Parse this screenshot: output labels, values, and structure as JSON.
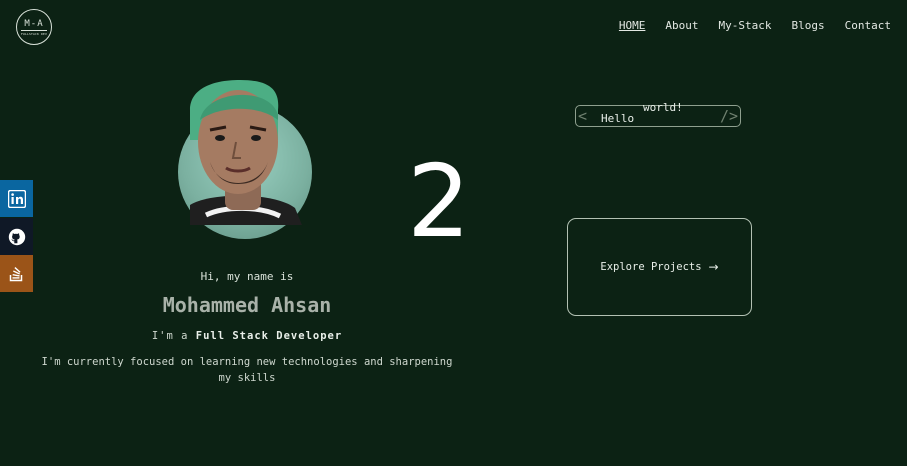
{
  "logo": {
    "initials": "M-A",
    "tagline": "FULLSTACK DEV"
  },
  "nav": {
    "items": [
      {
        "label": "HOME",
        "active": true
      },
      {
        "label": "About",
        "active": false
      },
      {
        "label": "My-Stack",
        "active": false
      },
      {
        "label": "Blogs",
        "active": false
      },
      {
        "label": "Contact",
        "active": false
      }
    ]
  },
  "social": [
    {
      "icon": "linkedin-icon",
      "color": "#0a66a0"
    },
    {
      "icon": "github-icon",
      "color": "#0f1826"
    },
    {
      "icon": "stackoverflow-icon",
      "color": "#9b5418"
    }
  ],
  "overlay_number": "2",
  "hero": {
    "greeting": "Hi, my name is",
    "name": "Mohammed Ahsan",
    "role_prefix": "I'm a",
    "role": "Full Stack Developer",
    "description": "I'm currently focused on learning new technologies and sharpening my skills"
  },
  "code_box": {
    "word1": "Hello",
    "word2": "world!",
    "open": "<",
    "close": "/>"
  },
  "explore": {
    "label": "Explore Projects",
    "arrow": "→"
  }
}
